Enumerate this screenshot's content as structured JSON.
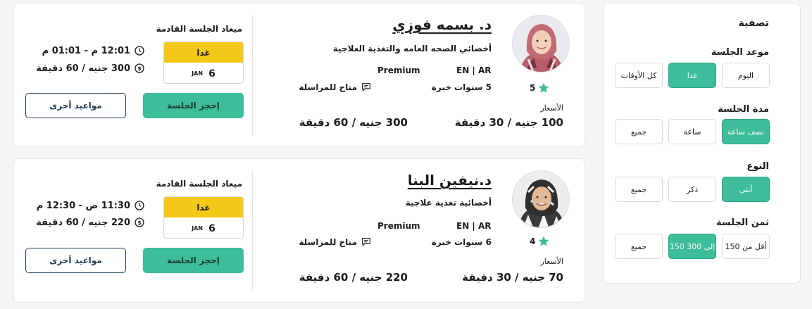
{
  "filter": {
    "title": "تصفية",
    "session_time": {
      "label": "موعد الجلسة",
      "options": [
        "اليوم",
        "غدا",
        "كل الأوقات"
      ],
      "selected": "غدا"
    },
    "duration": {
      "label": "مدة الجلسة",
      "options": [
        "نصف ساعة",
        "ساعة",
        "جميع"
      ],
      "selected": "نصف ساعة"
    },
    "gender": {
      "label": "النوع",
      "options": [
        "أنثى",
        "ذكر",
        "جميع"
      ],
      "selected": "أنثى"
    },
    "price": {
      "label": "ثمن الجلسة",
      "options": [
        "أقل من 150",
        "150 إلى 300",
        "جميع"
      ],
      "selected": "150 إلى 300"
    }
  },
  "doctors": [
    {
      "name": "د. بسمه فوزي",
      "specialty": "أخصائي الصحه العامه والتغذية العلاجية",
      "languages": "EN | AR",
      "tier": "Premium",
      "rating": "5",
      "experience": "5 سنوات خبرة",
      "messaging": "متاح للمراسلة",
      "prices_label": "الأسعار",
      "price_short": "100 جنيه / 30 دقيقة",
      "price_long": "300 جنيه / 60 دقيقة",
      "next_label": "ميعاد الجلسة القادمة",
      "next_time": "12:01 م - 01:01 م",
      "next_price": "300 جنيه / 60 دقيقة",
      "date_top": "غدا",
      "date_day": "6",
      "date_month": "JAN",
      "book": "إحجز الجلسة",
      "other": "مواعيد أخرى"
    },
    {
      "name": "د.نيفين البنا",
      "specialty": "أخصائية تغذية علاجية",
      "languages": "EN | AR",
      "tier": "Premium",
      "rating": "4",
      "experience": "6 سنوات خبرة",
      "messaging": "متاح للمراسلة",
      "prices_label": "الأسعار",
      "price_short": "70 جنيه / 30 دقيقة",
      "price_long": "220 جنيه / 60 دقيقة",
      "next_label": "ميعاد الجلسة القادمة",
      "next_time": "11:30 ص - 12:30 م",
      "next_price": "220 جنيه / 60 دقيقة",
      "date_top": "غدا",
      "date_day": "6",
      "date_month": "JAN",
      "book": "إحجز الجلسة",
      "other": "مواعيد أخرى"
    }
  ],
  "icons": {
    "star": "star-icon",
    "chat": "chat-icon",
    "clock": "clock-icon",
    "currency": "dollar-circle-icon"
  },
  "colors": {
    "accent": "#3dbd9a",
    "date_highlight": "#f3c817",
    "outline": "#1f3e5a"
  }
}
